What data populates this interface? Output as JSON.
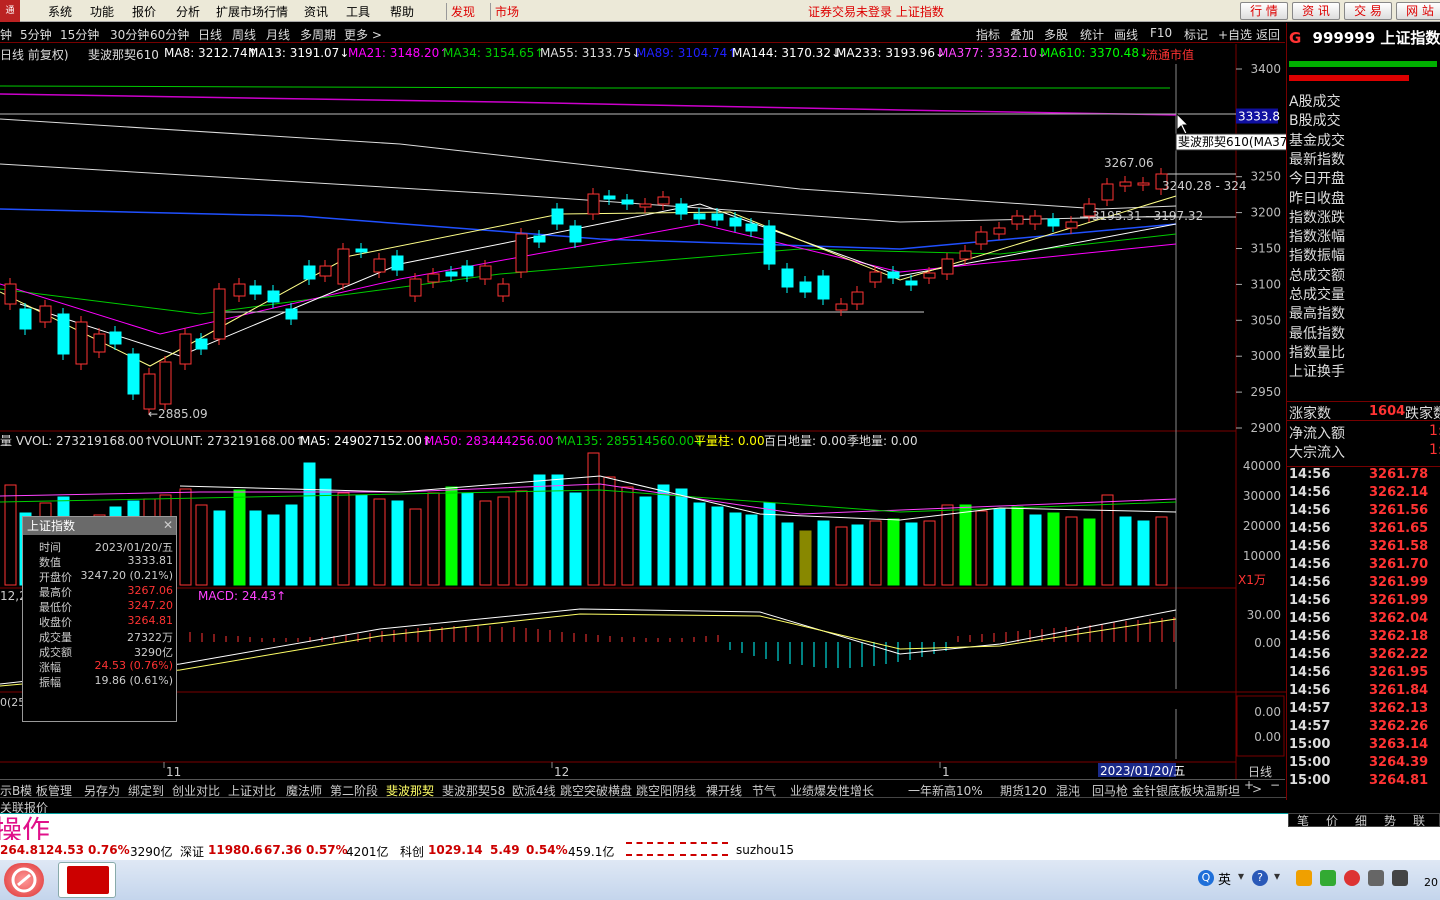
{
  "menu": {
    "logo": "通",
    "items": [
      "系统",
      "功能",
      "报价",
      "分析",
      "扩展市场行情",
      "资讯",
      "工具",
      "帮助"
    ],
    "highlight": [
      "发现",
      "市场"
    ],
    "notice": "证券交易未登录 上证指数",
    "buttons": [
      "行 情",
      "资 讯",
      "交 易",
      "网 站"
    ]
  },
  "periods": [
    "钟",
    "5分钟",
    "15分钟",
    "30分钟",
    "60分钟",
    "日线",
    "周线",
    "月线",
    "多周期",
    "更多 >"
  ],
  "toolbar_right": [
    "指标",
    "叠加",
    "多股",
    "统计",
    "画线",
    "F10",
    "标记",
    "+自选",
    "返回"
  ],
  "ma_line": {
    "prefix": "日线 前复权)",
    "items": [
      {
        "t": "斐波那契610",
        "c": "#dddddd"
      },
      {
        "t": "MA8: 3212.74↑",
        "c": "#ffffff"
      },
      {
        "t": "MA13: 3191.07↓",
        "c": "#ffffff"
      },
      {
        "t": "MA21: 3148.20↑",
        "c": "#ff00ff"
      },
      {
        "t": "MA34: 3154.65↑",
        "c": "#00cc00"
      },
      {
        "t": "MA55: 3133.75↓",
        "c": "#dddddd"
      },
      {
        "t": "MA89: 3104.74↑",
        "c": "#2020ff"
      },
      {
        "t": "MA144: 3170.32↓",
        "c": "#ffffff"
      },
      {
        "t": "MA233: 3193.96↓",
        "c": "#ffffff"
      },
      {
        "t": "MA377: 3332.10↓",
        "c": "#ff44ff"
      },
      {
        "t": "MA610: 3370.48↓",
        "c": "#00ff00"
      },
      {
        "t": "流通市值",
        "c": "#ff3333"
      }
    ]
  },
  "price_axis": [
    "3400",
    "3300",
    "3250",
    "3200",
    "3150",
    "3100",
    "3050",
    "3000",
    "2950",
    "2900"
  ],
  "price_tag": "3333.8",
  "tooltip": "斐波那契610(MA377):3332.10",
  "annotations": {
    "high": "3267.06",
    "low": "←2885.09",
    "range": "3240.28 - 324",
    "range2": "3195.31 - 3197.32"
  },
  "volume_line": {
    "items": [
      {
        "t": "量 VVOL: 273219168.00↑",
        "c": "#dddddd"
      },
      {
        "t": "VOLUNT: 273219168.00↑",
        "c": "#dddddd"
      },
      {
        "t": "MA5: 249027152.00↑",
        "c": "#ffffff"
      },
      {
        "t": "MA50: 283444256.00↑",
        "c": "#ff00ff"
      },
      {
        "t": "MA135: 285514560.00↓",
        "c": "#00cc00"
      },
      {
        "t": "平量柱: 0.00",
        "c": "#ffff00"
      },
      {
        "t": "百日地量: 0.00",
        "c": "#dddddd"
      },
      {
        "t": "季地量: 0.00",
        "c": "#dddddd"
      }
    ]
  },
  "volume_axis": [
    "40000",
    "30000",
    "20000",
    "10000"
  ],
  "volume_unit": "X1万",
  "macd_line": {
    "label": "MACD: 24.43↑",
    "prefix": "12,2"
  },
  "macd_axis": [
    "30.00",
    "0.00"
  ],
  "extra_axis": [
    "0.00",
    "0.00"
  ],
  "date_axis": [
    "11",
    "12",
    "1"
  ],
  "date_badge": "2023/01/20/五",
  "period_label": "日线",
  "info": {
    "title": "上证指数",
    "rows": [
      {
        "k": "时间",
        "v": "2023/01/20/五",
        "c": "#cccccc"
      },
      {
        "k": "数值",
        "v": "3333.81",
        "c": "#cccccc"
      },
      {
        "k": "开盘价",
        "v": "3247.20 (0.21%)",
        "c": "#cccccc"
      },
      {
        "k": "最高价",
        "v": "3267.06",
        "c": "#ff3333"
      },
      {
        "k": "最低价",
        "v": "3247.20",
        "c": "#ff3333"
      },
      {
        "k": "收盘价",
        "v": "3264.81",
        "c": "#ff3333"
      },
      {
        "k": "成交量",
        "v": "27322万",
        "c": "#cccccc"
      },
      {
        "k": "成交额",
        "v": "3290亿",
        "c": "#cccccc"
      },
      {
        "k": "涨幅",
        "v": "24.53 (0.76%)",
        "c": "#ff3333"
      },
      {
        "k": "振幅",
        "v": "19.86 (0.61%)",
        "c": "#cccccc"
      }
    ]
  },
  "right_panel": {
    "code": "999999",
    "name": "上证指数",
    "labels": [
      "A股成交",
      "B股成交",
      "基金成交",
      "最新指数",
      "今日开盘",
      "昨日收盘",
      "指数涨跌",
      "指数涨幅",
      "指数振幅",
      "总成交额",
      "总成交量",
      "最高指数",
      "最低指数",
      "指数量比",
      "上证换手"
    ],
    "rise_label": "涨家数",
    "rise_value": "1604",
    "fall_label": "跌家数",
    "flow": [
      "净流入额",
      "大宗流入"
    ],
    "flow_value": "1:",
    "ticks": [
      {
        "t": "14:56",
        "p": "3261.78"
      },
      {
        "t": "14:56",
        "p": "3262.14"
      },
      {
        "t": "14:56",
        "p": "3261.56"
      },
      {
        "t": "14:56",
        "p": "3261.65"
      },
      {
        "t": "14:56",
        "p": "3261.58"
      },
      {
        "t": "14:56",
        "p": "3261.70"
      },
      {
        "t": "14:56",
        "p": "3261.99"
      },
      {
        "t": "14:56",
        "p": "3261.99"
      },
      {
        "t": "14:56",
        "p": "3262.04"
      },
      {
        "t": "14:56",
        "p": "3262.18"
      },
      {
        "t": "14:56",
        "p": "3262.22"
      },
      {
        "t": "14:56",
        "p": "3261.95"
      },
      {
        "t": "14:56",
        "p": "3261.84"
      },
      {
        "t": "14:57",
        "p": "3262.13"
      },
      {
        "t": "14:57",
        "p": "3262.26"
      },
      {
        "t": "15:00",
        "p": "3263.14"
      },
      {
        "t": "15:00",
        "p": "3264.39"
      },
      {
        "t": "15:00",
        "p": "3264.81"
      }
    ],
    "bottom_tabs": [
      "笔",
      "价",
      "细",
      "势",
      "联"
    ]
  },
  "bottom_tabs": [
    "示B",
    "模 板",
    "管理",
    "另存为",
    "绑定到",
    "创业对比",
    "上证对比",
    "魔法师",
    "第二阶段",
    "斐波那契",
    "斐波那契58",
    "欧派4线",
    "跳空突破横盘",
    "跳空阳阴线",
    "裸开线",
    "节气",
    "业绩爆发性增长",
    "一年新高10%",
    "期货120",
    "混沌",
    "回马枪",
    "金针银底",
    "板块温斯坦",
    ">"
  ],
  "bottom_right": [
    "+",
    "−"
  ],
  "left_caption": "关联报价",
  "watermark": "操作",
  "status": [
    {
      "t": "264.81",
      "c": "#cc0000",
      "b": true
    },
    {
      "t": "24.53",
      "c": "#cc0000",
      "b": true
    },
    {
      "t": "0.76%",
      "c": "#cc0000",
      "b": true
    },
    {
      "t": "3290亿",
      "c": "#000000",
      "b": false
    },
    {
      "t": "深证",
      "c": "#000000",
      "b": false
    },
    {
      "t": "11980.6",
      "c": "#cc0000",
      "b": true
    },
    {
      "t": "67.36",
      "c": "#cc0000",
      "b": true
    },
    {
      "t": "0.57%",
      "c": "#cc0000",
      "b": true
    },
    {
      "t": "4201亿",
      "c": "#000000",
      "b": false
    },
    {
      "t": "科创",
      "c": "#000000",
      "b": false
    },
    {
      "t": "1029.14",
      "c": "#cc0000",
      "b": true
    },
    {
      "t": "5.49",
      "c": "#cc0000",
      "b": true
    },
    {
      "t": "0.54%",
      "c": "#cc0000",
      "b": true
    },
    {
      "t": "459.1亿",
      "c": "#000000",
      "b": false
    },
    {
      "t": "suzhou15",
      "c": "#000000",
      "b": false
    }
  ],
  "taskbar": {
    "ime": "英",
    "clock": "20"
  },
  "colors": {
    "up": "#ff3333",
    "down": "#00ffff",
    "bg": "#000000",
    "grid": "#7a0000"
  }
}
